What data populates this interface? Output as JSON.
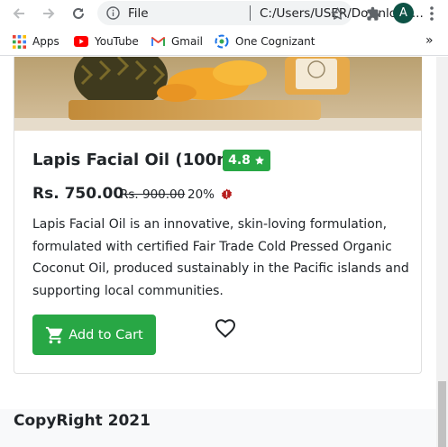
{
  "browser": {
    "omnibox": {
      "scheme_label": "File",
      "url": "C:/Users/USER/Download..."
    },
    "profile_initial": "A",
    "bookmarks": [
      {
        "label": "Apps",
        "icon": "apps-grid-icon"
      },
      {
        "label": "YouTube",
        "icon": "youtube-icon"
      },
      {
        "label": "Gmail",
        "icon": "gmail-icon"
      },
      {
        "label": "One Cognizant",
        "icon": "cognizant-icon"
      }
    ],
    "bookmarks_overflow": "»"
  },
  "product": {
    "title": "Lapis Facial Oil (100ml)",
    "rating": "4.8",
    "price": "Rs. 750.00",
    "original_price": "Rs. 900.00",
    "discount": "20%",
    "description": "Lapis Facial Oil is an innovative, skin-loving formulation, formulated with certified Fair Trade Cold Pressed Organic Coconut Oil, produced sustainably in the Pacific islands and supporting local communities.",
    "add_to_cart_label": "Add to Cart"
  },
  "footer": {
    "copyright": "CopyRight 2021"
  },
  "colors": {
    "accent_green": "#28a745",
    "badge_red": "#c0392b"
  }
}
